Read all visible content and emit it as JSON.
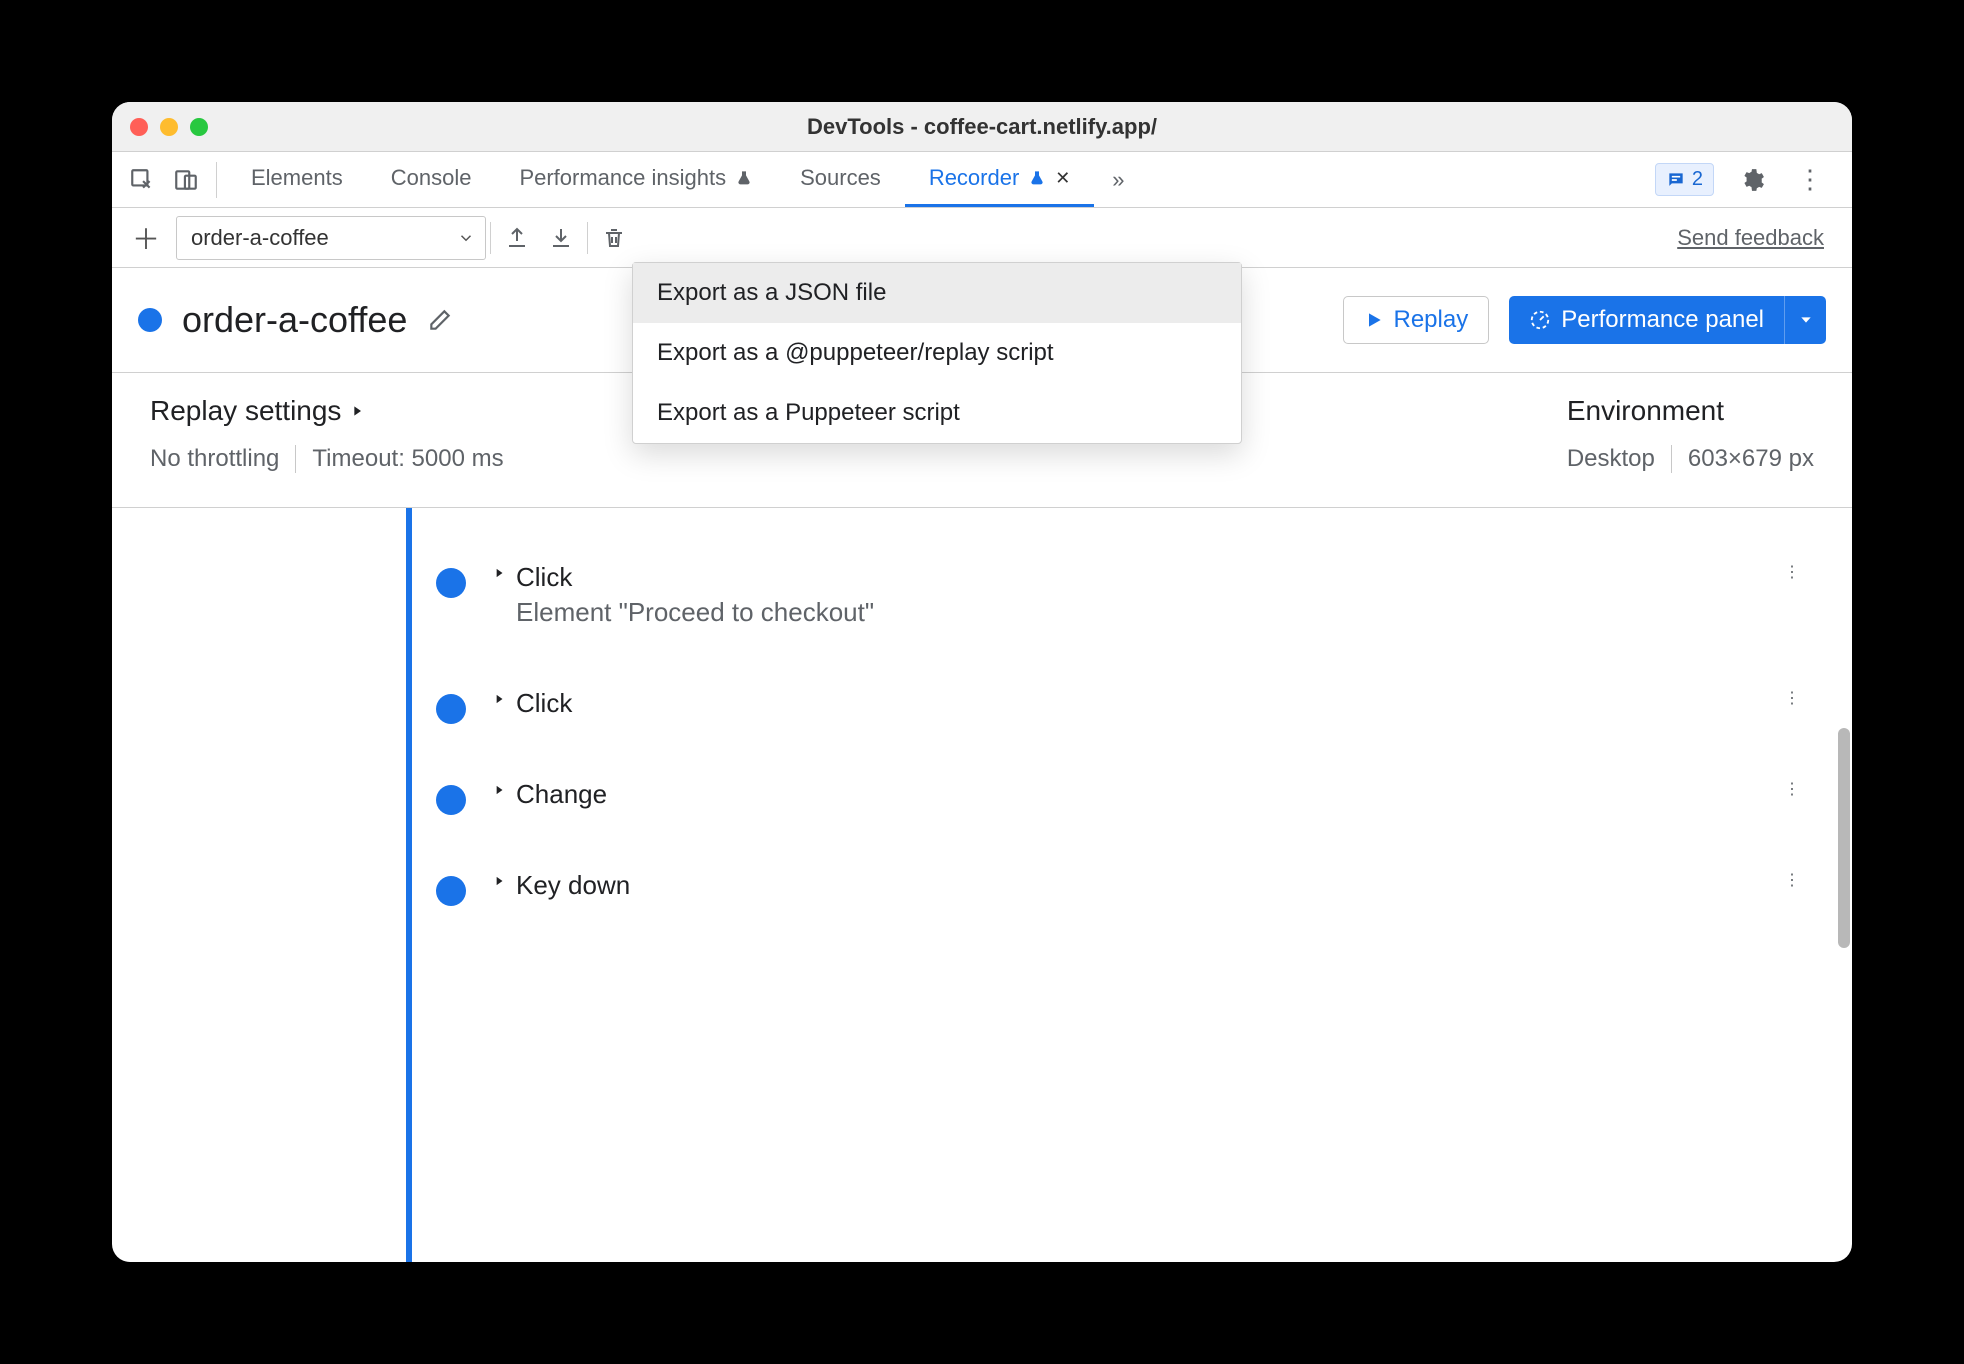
{
  "window": {
    "title": "DevTools - coffee-cart.netlify.app/"
  },
  "tabs": {
    "items": [
      "Elements",
      "Console",
      "Performance insights",
      "Sources",
      "Recorder"
    ],
    "active_index": 4
  },
  "issues_count": "2",
  "toolbar": {
    "recording_name": "order-a-coffee",
    "feedback_label": "Send feedback",
    "export_menu": [
      "Export as a JSON file",
      "Export as a @puppeteer/replay script",
      "Export as a Puppeteer script"
    ],
    "export_highlight_index": 0
  },
  "header": {
    "title": "order-a-coffee",
    "replay_label": "Replay",
    "perf_label": "Performance panel"
  },
  "settings": {
    "replay_heading": "Replay settings",
    "throttling": "No throttling",
    "timeout": "Timeout: 5000 ms",
    "env_heading": "Environment",
    "device": "Desktop",
    "dimensions": "603×679 px"
  },
  "steps": [
    {
      "title": "Click",
      "detail": "Element \"Proceed to checkout\""
    },
    {
      "title": "Click",
      "detail": ""
    },
    {
      "title": "Change",
      "detail": ""
    },
    {
      "title": "Key down",
      "detail": ""
    }
  ]
}
